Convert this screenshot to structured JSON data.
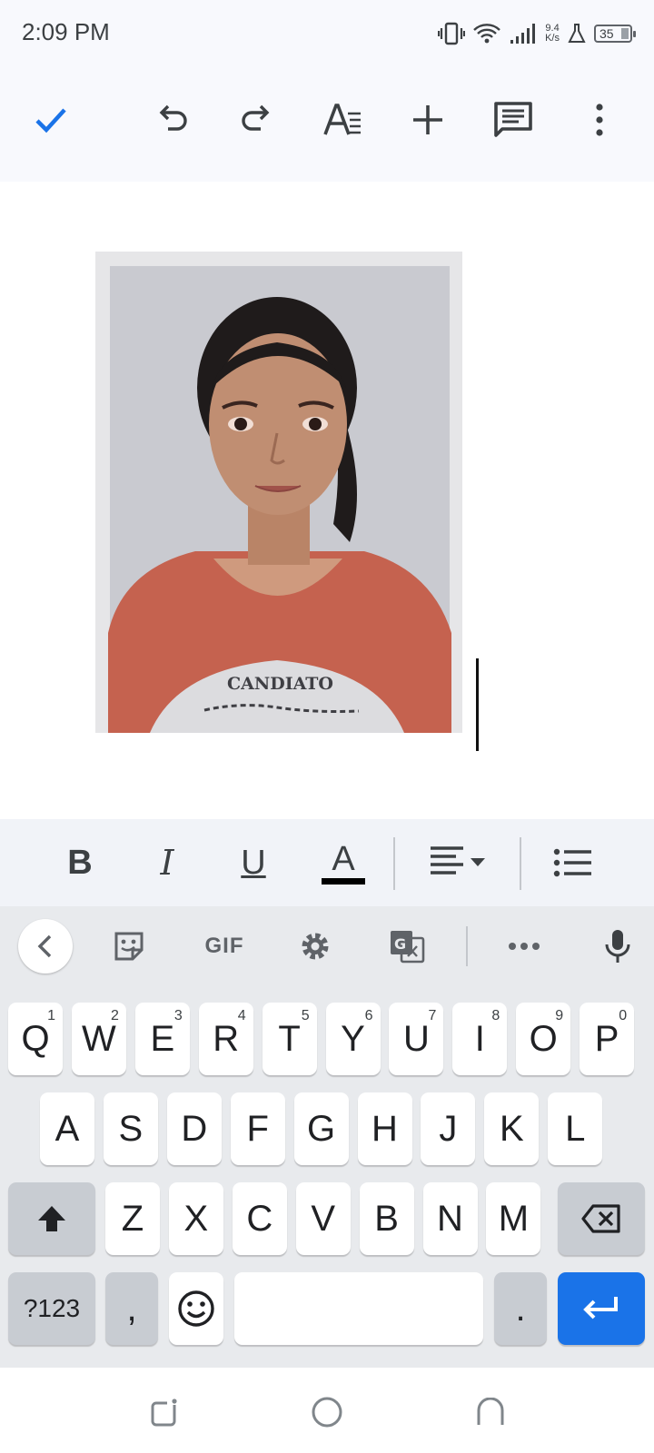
{
  "status_bar": {
    "time": "2:09 PM",
    "net_speed_value": "9.4",
    "net_speed_unit": "K/s",
    "battery": "35"
  },
  "toolbar": {
    "icons": [
      "check-icon",
      "undo-icon",
      "redo-icon",
      "text-format-icon",
      "add-icon",
      "comment-icon",
      "more-vert-icon"
    ],
    "accent": "#1a73e8"
  },
  "document": {
    "image_caption_text": "CANDIATO"
  },
  "format_bar": {
    "bold": "B",
    "italic": "I",
    "underline": "U",
    "text_color": "A",
    "text_color_value": "#000000"
  },
  "keyboard": {
    "strip": {
      "gif_label": "GIF"
    },
    "row1": [
      {
        "label": "Q",
        "hint": "1"
      },
      {
        "label": "W",
        "hint": "2"
      },
      {
        "label": "E",
        "hint": "3"
      },
      {
        "label": "R",
        "hint": "4"
      },
      {
        "label": "T",
        "hint": "5"
      },
      {
        "label": "Y",
        "hint": "6"
      },
      {
        "label": "U",
        "hint": "7"
      },
      {
        "label": "I",
        "hint": "8"
      },
      {
        "label": "O",
        "hint": "9"
      },
      {
        "label": "P",
        "hint": "0"
      }
    ],
    "row2": [
      "A",
      "S",
      "D",
      "F",
      "G",
      "H",
      "J",
      "K",
      "L"
    ],
    "row3": [
      "Z",
      "X",
      "C",
      "V",
      "B",
      "N",
      "M"
    ],
    "symbols_label": "?123",
    "comma_label": ",",
    "period_label": ".",
    "enter_color": "#1a73e8"
  }
}
